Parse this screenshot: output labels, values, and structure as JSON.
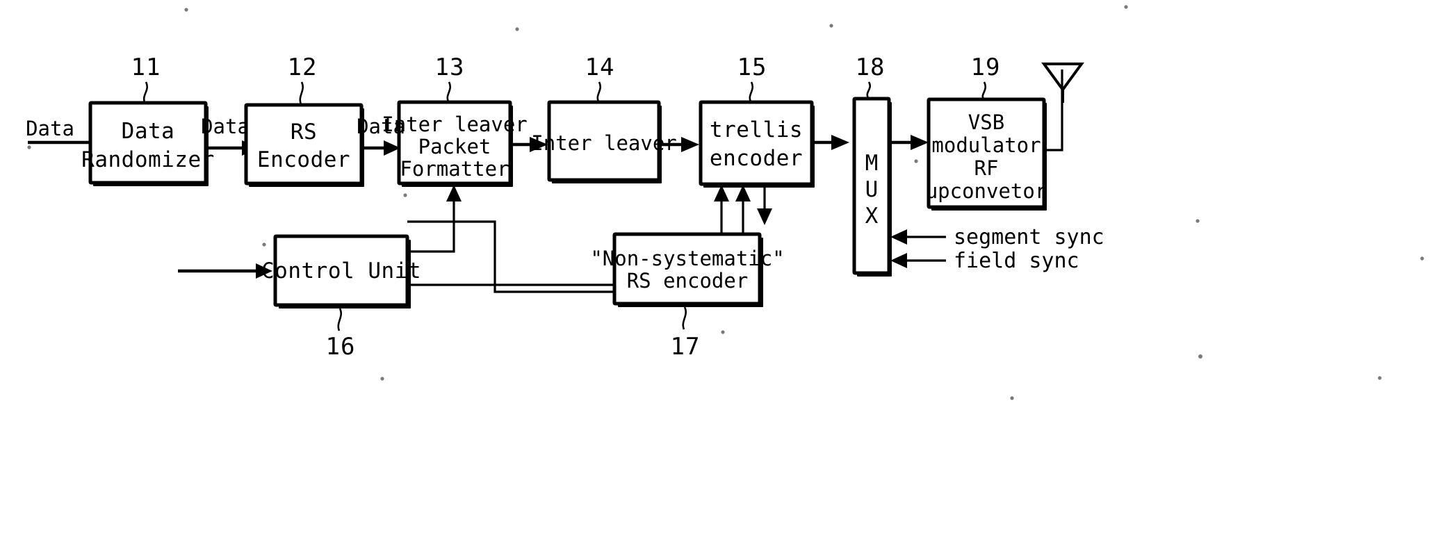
{
  "figure": {
    "type": "block-diagram",
    "title": "",
    "blocks": [
      {
        "id": "11",
        "ref": "11",
        "lines": [
          "Data",
          "Randomizer"
        ],
        "name": "data-randomizer"
      },
      {
        "id": "12",
        "ref": "12",
        "lines": [
          "RS",
          "Encoder"
        ],
        "name": "rs-encoder"
      },
      {
        "id": "13",
        "ref": "13",
        "lines": [
          "Inter leaver",
          "Packet",
          "Formatter"
        ],
        "name": "interleaver-packet-formatter"
      },
      {
        "id": "14",
        "ref": "14",
        "lines": [
          "Inter leaver"
        ],
        "name": "interleaver"
      },
      {
        "id": "15",
        "ref": "15",
        "lines": [
          "trellis",
          "encoder"
        ],
        "name": "trellis-encoder"
      },
      {
        "id": "16",
        "ref": "16",
        "lines": [
          "Control Unit"
        ],
        "name": "control-unit"
      },
      {
        "id": "17",
        "ref": "17",
        "lines": [
          "\"Non-systematic\"",
          "RS encoder"
        ],
        "name": "non-systematic-rs-encoder"
      },
      {
        "id": "18",
        "ref": "18",
        "lines": [
          "M",
          "U",
          "X"
        ],
        "name": "mux"
      },
      {
        "id": "19",
        "ref": "19",
        "lines": [
          "VSB",
          "modulator",
          "RF",
          "upconvetor"
        ],
        "name": "vsb-modulator-rf-upconvetor"
      }
    ],
    "edge_labels": [
      {
        "text": "Data",
        "name": "input-data-label"
      },
      {
        "text": "Data",
        "name": "randomizer-out-data-label"
      },
      {
        "text": "Data",
        "name": "rs-encoder-out-data-label"
      }
    ],
    "signals": [
      {
        "text": "segment sync",
        "name": "segment-sync-label"
      },
      {
        "text": "field sync",
        "name": "field-sync-label"
      }
    ],
    "antenna": {
      "name": "antenna-icon",
      "label": ""
    },
    "colors": {
      "ink": "#000000",
      "paper": "#ffffff"
    }
  }
}
